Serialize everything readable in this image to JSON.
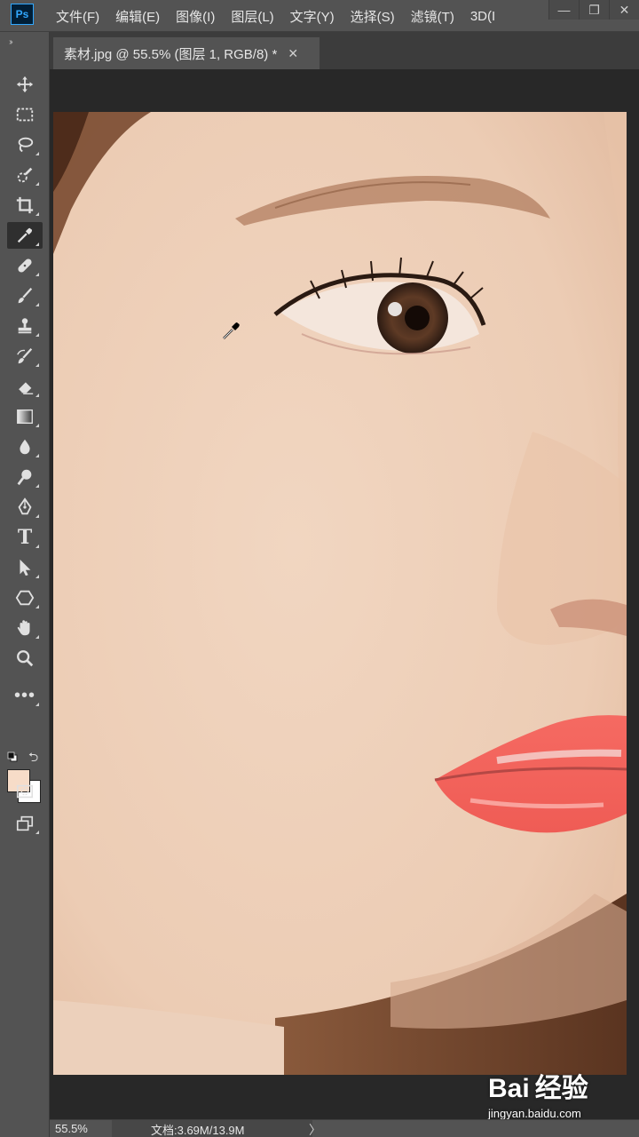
{
  "app": {
    "logo": "Ps"
  },
  "menu": [
    "文件(F)",
    "编辑(E)",
    "图像(I)",
    "图层(L)",
    "文字(Y)",
    "选择(S)",
    "滤镜(T)",
    "3D(I"
  ],
  "window_controls": {
    "minimize": "—",
    "restore": "❐",
    "close": "✕"
  },
  "document_tab": {
    "title": "素材.jpg @ 55.5% (图层 1, RGB/8) *",
    "close": "✕"
  },
  "toolbar": {
    "tools": [
      {
        "name": "move-tool",
        "icon": "move-icon"
      },
      {
        "name": "marquee-tool",
        "icon": "rect-marquee-icon"
      },
      {
        "name": "lasso-tool",
        "icon": "lasso-icon"
      },
      {
        "name": "quick-selection-tool",
        "icon": "quick-selection-icon"
      },
      {
        "name": "crop-tool",
        "icon": "crop-icon"
      },
      {
        "name": "eyedropper-tool",
        "icon": "eyedropper-icon",
        "active": true
      },
      {
        "name": "healing-brush-tool",
        "icon": "bandage-icon"
      },
      {
        "name": "brush-tool",
        "icon": "brush-icon"
      },
      {
        "name": "clone-stamp-tool",
        "icon": "stamp-icon"
      },
      {
        "name": "history-brush-tool",
        "icon": "history-brush-icon"
      },
      {
        "name": "eraser-tool",
        "icon": "eraser-icon"
      },
      {
        "name": "gradient-tool",
        "icon": "gradient-icon"
      },
      {
        "name": "blur-tool",
        "icon": "drop-icon"
      },
      {
        "name": "dodge-tool",
        "icon": "dodge-icon"
      },
      {
        "name": "pen-tool",
        "icon": "pen-icon"
      },
      {
        "name": "type-tool",
        "icon": "type-icon",
        "label": "T"
      },
      {
        "name": "path-selection-tool",
        "icon": "arrow-icon"
      },
      {
        "name": "shape-tool",
        "icon": "hexagon-icon"
      },
      {
        "name": "hand-tool",
        "icon": "hand-icon"
      },
      {
        "name": "zoom-tool",
        "icon": "zoom-icon"
      },
      {
        "name": "more-tools",
        "icon": "more-dots-icon",
        "label": "•••"
      }
    ],
    "foreground_color": "#f7dcc8",
    "background_color": "#ffffff",
    "swap_label": "⮌"
  },
  "canvas": {
    "background": "#282828"
  },
  "watermark": {
    "logo": "Bai 经验",
    "url": "jingyan.baidu.com"
  },
  "statusbar": {
    "zoom": "55.5%",
    "doc_info": "文档:3.69M/13.9M",
    "arrow": "〉"
  },
  "colors": {
    "ui_panel": "#535353",
    "ui_dark": "#3c3c3c",
    "accent": "#31a8ff",
    "lip": "#f2655d",
    "skin": "#eed2bd"
  }
}
